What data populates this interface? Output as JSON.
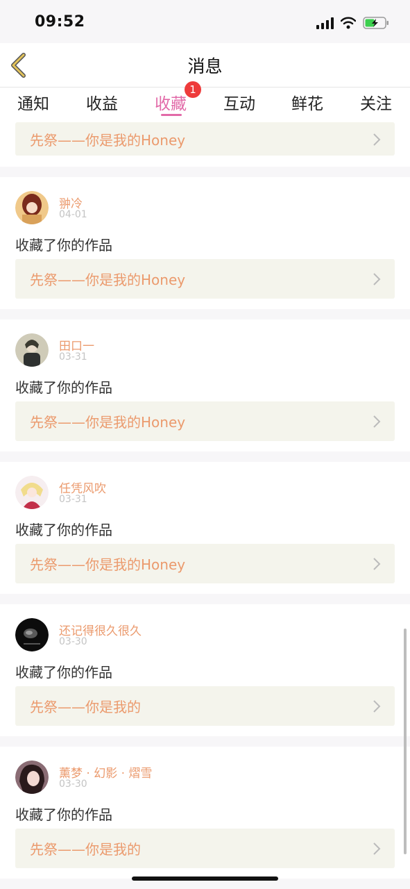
{
  "status": {
    "time": "09:52"
  },
  "header": {
    "title": "消息"
  },
  "tabs": [
    {
      "label": "通知"
    },
    {
      "label": "收益"
    },
    {
      "label": "收藏"
    },
    {
      "label": "互动"
    },
    {
      "label": "鲜花"
    },
    {
      "label": "关注"
    }
  ],
  "active_tab_badge": "1",
  "partial_item": {
    "work": "先祭——你是我的Honey"
  },
  "items": [
    {
      "user": "翀冷",
      "date": "04-01",
      "action": "收藏了你的作品",
      "work": "先祭——你是我的Honey"
    },
    {
      "user": "田口一",
      "date": "03-31",
      "action": "收藏了你的作品",
      "work": "先祭——你是我的Honey"
    },
    {
      "user": "任凭风吹",
      "date": "03-31",
      "action": "收藏了你的作品",
      "work": "先祭——你是我的Honey"
    },
    {
      "user": "还记得很久很久",
      "date": "03-30",
      "action": "收藏了你的作品",
      "work": "先祭——你是我的"
    },
    {
      "user": "薰梦 · 幻影 · 熠雪",
      "date": "03-30",
      "action": "收藏了你的作品",
      "work": "先祭——你是我的"
    }
  ],
  "colors": {
    "accent": "#e26aa8",
    "username": "#eb9a6d",
    "badge": "#ee3b3b",
    "back_arrow": "#e3c35a",
    "card_work_bg": "#f4f4ec"
  },
  "icons": [
    "back-arrow-icon",
    "cellular-signal-icon",
    "wifi-icon",
    "battery-charging-icon",
    "chevron-right-icon"
  ]
}
